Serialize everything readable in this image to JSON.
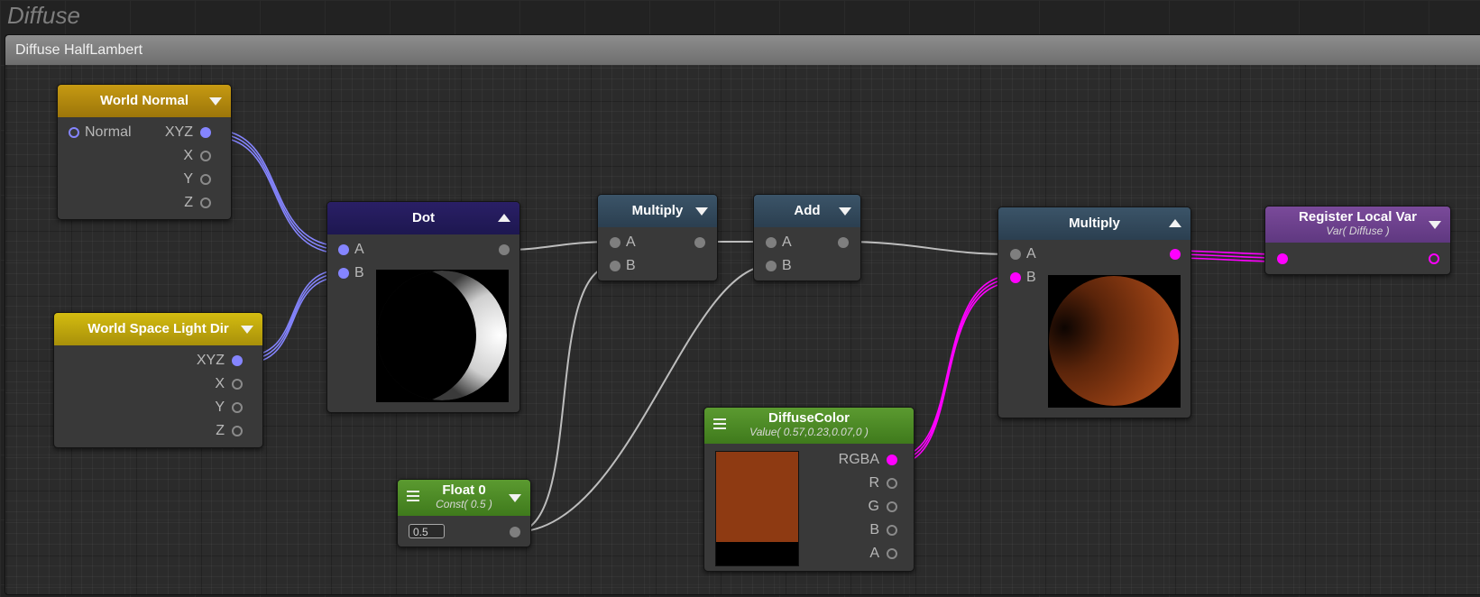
{
  "graph": {
    "title": "Diffuse"
  },
  "group": {
    "title": "Diffuse HalfLambert"
  },
  "colors": {
    "wire_vector": "#8585ff",
    "wire_float": "#bdbdbd",
    "wire_color": "#ff00ff"
  },
  "nodes": {
    "world_normal": {
      "title": "World Normal",
      "inputs": [
        "Normal"
      ],
      "outputs": [
        "XYZ",
        "X",
        "Y",
        "Z"
      ]
    },
    "world_light_dir": {
      "title": "World Space Light Dir",
      "outputs": [
        "XYZ",
        "X",
        "Y",
        "Z"
      ]
    },
    "dot": {
      "title": "Dot",
      "inputs": [
        "A",
        "B"
      ]
    },
    "multiply_1": {
      "title": "Multiply",
      "inputs": [
        "A",
        "B"
      ]
    },
    "add": {
      "title": "Add",
      "inputs": [
        "A",
        "B"
      ]
    },
    "multiply_2": {
      "title": "Multiply",
      "inputs": [
        "A",
        "B"
      ]
    },
    "register_local_var": {
      "title": "Register Local Var",
      "subtitle": "Var( Diffuse )"
    },
    "float": {
      "title": "Float 0",
      "subtitle": "Const( 0.5 )",
      "value": "0.5"
    },
    "diffuse_color": {
      "title": "DiffuseColor",
      "subtitle": "Value( 0.57,0.23,0.07,0 )",
      "outputs": [
        "RGBA",
        "R",
        "G",
        "B",
        "A"
      ],
      "swatch_color": "#8e3a12"
    }
  }
}
